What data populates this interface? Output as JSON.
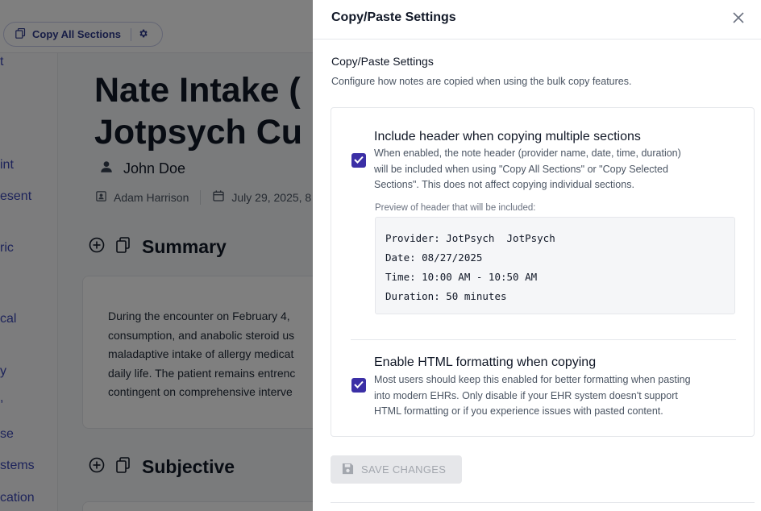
{
  "background": {
    "toolbar": {
      "copy_all_label": "Copy All Sections"
    },
    "sidebar": {
      "items": [
        "t",
        "int",
        "esent",
        "ric",
        "cal",
        "y",
        ",",
        "se",
        "stems",
        "cation"
      ]
    },
    "note": {
      "title_line1": "Nate Intake (",
      "title_line2": "Jotpsych Cu",
      "patient_name": "John Doe",
      "clinician": "Adam Harrison",
      "date": "July 29, 2025, 8"
    },
    "summary": {
      "heading": "Summary",
      "lines": [
        "During the encounter on February 4,",
        "consumption, and anabolic steroid us",
        "maladaptive intake of allergy medicat",
        "daily life. The patient remains entrenc",
        "contingent on comprehensive interve"
      ]
    },
    "subjective": {
      "heading": "Subjective"
    }
  },
  "drawer": {
    "title": "Copy/Paste Settings",
    "section_title": "Copy/Paste Settings",
    "section_desc": "Configure how notes are copied when using the bulk copy features.",
    "options": [
      {
        "label": "Include header when copying multiple sections",
        "desc_lines": [
          "When enabled, the note header (provider name, date, time, duration)",
          "will be included when using \"Copy All Sections\" or \"Copy Selected",
          "Sections\". This does not affect copying individual sections."
        ],
        "checked": true
      },
      {
        "label": "Enable HTML formatting when copying",
        "desc_lines": [
          "Most users should keep this enabled for better formatting when pasting",
          "into modern EHRs. Only disable if your EHR system doesn't support",
          "HTML formatting or if you experience issues with pasted content."
        ],
        "checked": true
      }
    ],
    "preview": {
      "label": "Preview of header that will be included:",
      "lines": [
        "Provider: JotPsych  JotPsych",
        "Date: 08/27/2025",
        "Time: 10:00 AM - 10:50 AM",
        "Duration: 50 minutes"
      ]
    },
    "save_button": {
      "label": "SAVE CHANGES",
      "disabled": true
    }
  },
  "colors": {
    "accent": "#3b2fa6",
    "link": "#3b47b5",
    "overlay": "rgba(0,0,0,0.5)",
    "disabled_bg": "#e6e7ea",
    "disabled_text": "#a3a7ae"
  },
  "icons": {
    "copy_all": "copy-icon",
    "settings": "gear-icon",
    "close": "close-icon",
    "patient": "person-icon",
    "clinician": "badge-icon",
    "date": "calendar-icon",
    "add": "plus-circle-icon",
    "copy_section": "copy-icon",
    "checkbox": "check-icon",
    "save": "floppy-disk-icon"
  }
}
